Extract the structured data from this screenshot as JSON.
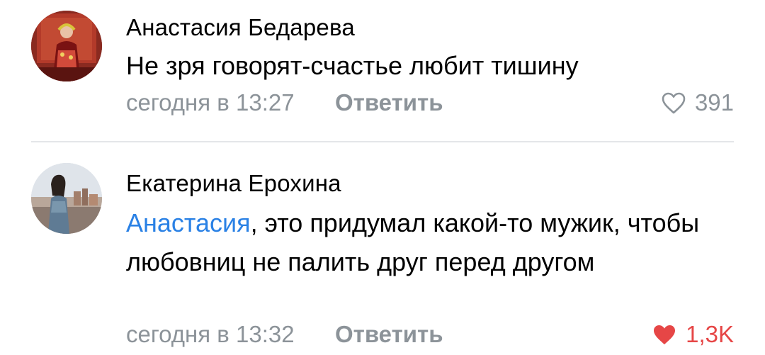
{
  "comments": [
    {
      "author": "Анастасия Бедарева",
      "text": "Не зря говорят-счастье любит тишину",
      "time": "сегодня в 13:27",
      "reply_label": "Ответить",
      "likes": "391",
      "liked": false,
      "like_icon": "heart-outline-icon"
    },
    {
      "author": "Екатерина Ерохина",
      "mention": "Анастасия",
      "text": ", это придумал какой-то мужик, чтобы любовниц не палить друг перед другом",
      "time": "сегодня в 13:32",
      "reply_label": "Ответить",
      "likes": "1,3K",
      "liked": true,
      "like_icon": "heart-filled-icon"
    }
  ],
  "colors": {
    "mention": "#2a81e5",
    "meta": "#8c9399",
    "liked": "#e64646",
    "divider": "#e4e6e9"
  }
}
